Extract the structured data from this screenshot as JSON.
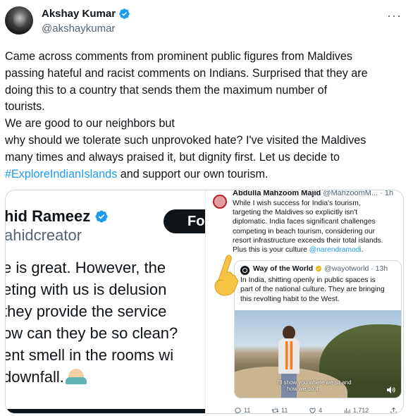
{
  "author": {
    "name": "Akshay Kumar",
    "handle": "@akshaykumar",
    "verified": true
  },
  "more_icon": "more-options-icon",
  "tweet": {
    "lines": [
      "Came across comments from prominent public figures from Maldives",
      "passing hateful and racist comments on Indians. Surprised that they are",
      "doing this to a country that sends them the maximum number of",
      "tourists.",
      "We are good to our neighbors but",
      "why should we tolerate such unprovoked hate? I've visited the Maldives",
      "many times and always praised it, but dignity first. Let us decide to"
    ],
    "hashtag": "#ExploreIndianIslands",
    "last_line_rest": " and support our own tourism."
  },
  "left_shot": {
    "name": "hid Rameez",
    "handle": "ahidcreator",
    "follow_label": "Fo",
    "lines": [
      "e is great. However, the",
      "eting with us is delusion",
      " they provide the service",
      "ow can they be so clean?",
      "ent smell in the rooms wi",
      "downfall."
    ]
  },
  "right_shot": {
    "name": "Abdulla Mahzoom Majid",
    "handle_time": "@MahzoomM... · 1h",
    "lines": [
      "While I wish success for India's tourism,",
      "targeting the Maldives so explicitly isn't",
      "diplomatic. India faces significant challenges",
      "competing in beach tourism, considering our",
      "resort infrastructure exceeds their total islands."
    ],
    "last_line_prefix": "Plus this is your culture ",
    "mention": "@narendramodi",
    "last_line_suffix": ".",
    "quote": {
      "name": "Way of the World",
      "handle_time": "@wayotworld · 13h",
      "lines": [
        "In India, shitting openly in public spaces is",
        "part of the national culture. They are bringing",
        "this revolting habit to the West."
      ],
      "video_caption_1": "I'll show you where we sit and",
      "video_caption_2": "how we do it"
    },
    "actions": {
      "replies": "11",
      "retweets": "11",
      "likes": "4",
      "views": "1,712"
    }
  },
  "colors": {
    "link": "#1d9bf0",
    "verified": "#1d9bf0",
    "text": "#0f1419",
    "muted": "#536471"
  }
}
